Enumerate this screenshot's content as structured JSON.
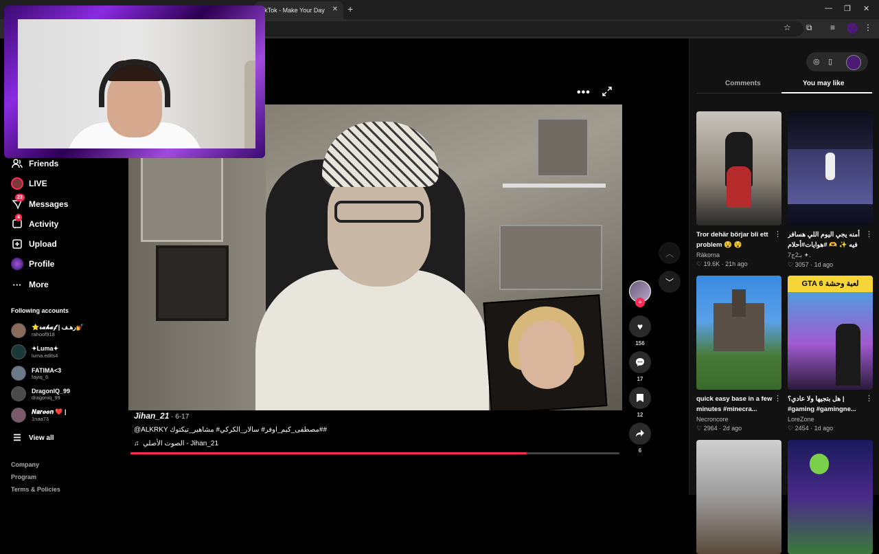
{
  "browser": {
    "tab_title": "TikTok - Make Your Day",
    "tab_close": "✕",
    "new_tab": "+",
    "controls": [
      "—",
      "❐",
      "✕"
    ]
  },
  "sidebar": {
    "nav": [
      {
        "label": "Friends",
        "icon": "friends-icon",
        "badge": ""
      },
      {
        "label": "LIVE",
        "icon": "live-icon",
        "badge": ""
      },
      {
        "label": "Messages",
        "icon": "messages-icon",
        "badge": "23"
      },
      {
        "label": "Activity",
        "icon": "activity-icon",
        "badge": "4"
      },
      {
        "label": "Upload",
        "icon": "upload-icon",
        "badge": ""
      },
      {
        "label": "Profile",
        "icon": "profile-icon",
        "badge": ""
      },
      {
        "label": "More",
        "icon": "more-icon",
        "badge": ""
      }
    ],
    "following_title": "Following accounts",
    "following": [
      {
        "name": "⭐𝓻𝓪𝓱𝓪𝓯 | رهـف💅",
        "handle": "rahoof918",
        "color": "#8a6a5a"
      },
      {
        "name": "✦Luma✦",
        "handle": "luma.edits4",
        "color": "#1a3a3a"
      },
      {
        "name": "FATIMA<3",
        "handle": "fayiq_6",
        "color": "#6a7a8a"
      },
      {
        "name": "DragonIQ_99",
        "handle": "dragoniq_99",
        "color": "#4a4a4a"
      },
      {
        "name": "𝑵𝒂𝒓𝒆𝒆𝒏 ❤️ |",
        "handle": "1naa73",
        "color": "#7a5a6a"
      }
    ],
    "view_all": "View all",
    "footer": [
      "Company",
      "Program",
      "Terms & Policies"
    ]
  },
  "video": {
    "author": "Jihan_21",
    "date": " · 6-17",
    "caption": "@ALKRKY مصطفى_كيم_اوفر# سالار_الكركي# مشاهير_تيكتوك##",
    "music_icon": "♫",
    "music": "الصوت الأصلي - Jihan_21",
    "progress": 0.81,
    "more": "•••",
    "likes": "156",
    "comments": "17",
    "saves": "12",
    "shares": "6"
  },
  "right_panel": {
    "tabs": [
      "Comments",
      "You may like"
    ],
    "active_tab": 1,
    "cards": [
      {
        "title": "Tror dehär börjar bli ett problem 😵 😵",
        "author": "Räkorna",
        "likes": "19.6K",
        "time": "21h ago",
        "bg": "linear-gradient(180deg,#c9c4bc,#8a8276 60%,#2a2a2a)"
      },
      {
        "title": "أمنه يجي اليوم اللي هسافر فيه ✨ 🫶 #هوايات#أحلام حقق احلامي ! ...",
        "author": "",
        "likes": "3057",
        "time": "1d ago",
        "extra": "بـ2ج7 ✦.",
        "bg": "linear-gradient(180deg,#0d0d1a,#2a2a4a 50%,#0d0d1a)"
      },
      {
        "title": "quick easy base in a few minutes #minecra...",
        "author": "Necroncore",
        "likes": "2964",
        "time": "2d ago",
        "bg": "linear-gradient(180deg,#3a8ae0,#5aa0e8 40%,#4a7a3a 70%,#3a6a2a)"
      },
      {
        "title": "هل بتجيها ولا عادي؟ | #gaming #gamingne...",
        "author": "LoreZone",
        "likes": "2454",
        "time": "1d ago",
        "bg": "linear-gradient(180deg,#f5d53a 0 14%,#3ab0e0 14%,#a05ad0 60%,#2a1a3a)"
      },
      {
        "title": "",
        "author": "",
        "likes": "",
        "time": "",
        "bg": "linear-gradient(180deg,#d0d0d0,#9a9a9a 50%,#5a4a3a)"
      },
      {
        "title": "",
        "author": "",
        "likes": "",
        "time": "",
        "bg": "linear-gradient(180deg,#1a1a5a,#4a2a8a 50%,#3a7a3a)"
      }
    ],
    "thumb_labels": {
      "gta": "GTA 6",
      "gta_ar": "لعبة وحشة"
    }
  }
}
